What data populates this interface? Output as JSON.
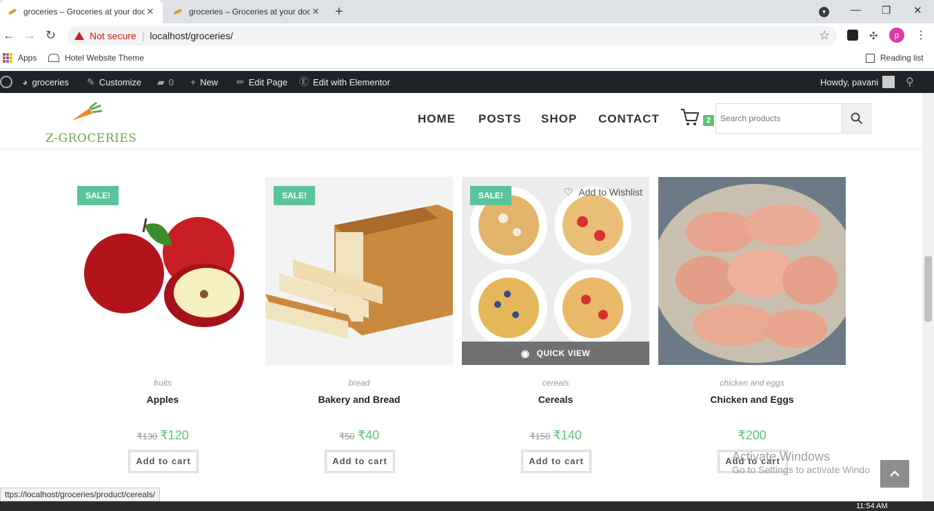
{
  "browser": {
    "tabs": [
      {
        "title": "groceries – Groceries at your doo",
        "active": true
      },
      {
        "title": "groceries – Groceries at your doo",
        "active": false
      }
    ],
    "not_secure": "Not secure",
    "url": "localhost/groceries/",
    "profile_letter": "p",
    "bookmarks": {
      "apps": "Apps",
      "hotel": "Hotel Website Theme",
      "reading_list": "Reading list"
    }
  },
  "wp_admin": {
    "site": "groceries",
    "customize": "Customize",
    "comments": "0",
    "new": "New",
    "edit_page": "Edit Page",
    "elementor": "Edit with Elementor",
    "howdy": "Howdy, pavani"
  },
  "site": {
    "logo_text": "Z-GROCERIES",
    "menu": [
      "HOME",
      "POSTS",
      "SHOP",
      "CONTACT"
    ],
    "cart_count": "2",
    "search_placeholder": "Search products"
  },
  "products": [
    {
      "category": "fruits",
      "name": "Apples",
      "old_price": "₹130",
      "price": "₹120",
      "sale": "SALE!",
      "button": "Add to cart"
    },
    {
      "category": "bread",
      "name": "Bakery and Bread",
      "old_price": "₹50",
      "price": "₹40",
      "sale": "SALE!",
      "button": "Add to cart"
    },
    {
      "category": "cereals",
      "name": "Cereals",
      "old_price": "₹150",
      "price": "₹140",
      "sale": "SALE!",
      "button": "Add to cart",
      "wishlist": "Add to Wishlist",
      "quick_view": "QUICK VIEW"
    },
    {
      "category": "chicken and eggs",
      "name": "Chicken and Eggs",
      "price": "₹200",
      "button": "Add to cart"
    }
  ],
  "overlay": {
    "activate_title": "Activate Windows",
    "activate_sub": "Go to Settings to activate Windo",
    "status_url": "ttps://localhost/groceries/product/cereals/",
    "clock": "11:54 AM"
  },
  "colors": {
    "accent_green": "#5bc37a",
    "sale_badge": "#5bc39b",
    "wp_bar": "#1d2327",
    "logo_green": "#6aa84f"
  }
}
